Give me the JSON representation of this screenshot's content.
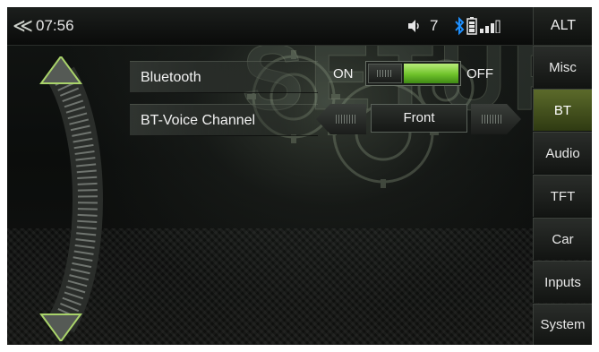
{
  "status_bar": {
    "back_icon": "double-chevron-left-icon",
    "time": "07:56",
    "volume_icon": "speaker-icon",
    "volume_level": "7",
    "bluetooth_icon": "bluetooth-icon",
    "battery_icon": "battery-icon",
    "signal_icon": "signal-bars-icon",
    "alt_label": "ALT"
  },
  "background": {
    "watermark": "SETUP"
  },
  "side_nav": {
    "items": [
      {
        "label": "Misc",
        "active": false
      },
      {
        "label": "BT",
        "active": true
      },
      {
        "label": "Audio",
        "active": false
      },
      {
        "label": "TFT",
        "active": false
      },
      {
        "label": "Car",
        "active": false
      },
      {
        "label": "Inputs",
        "active": false
      },
      {
        "label": "System",
        "active": false
      }
    ]
  },
  "settings": {
    "bluetooth": {
      "label": "Bluetooth",
      "on_label": "ON",
      "off_label": "OFF",
      "state": "ON"
    },
    "voice_channel": {
      "label": "BT-Voice Channel",
      "value": "Front"
    }
  },
  "colors": {
    "accent_green": "#7ccf33",
    "active_tab": "#4a5a20",
    "bluetooth_blue": "#1e90ff",
    "text": "#f2f2f2"
  }
}
